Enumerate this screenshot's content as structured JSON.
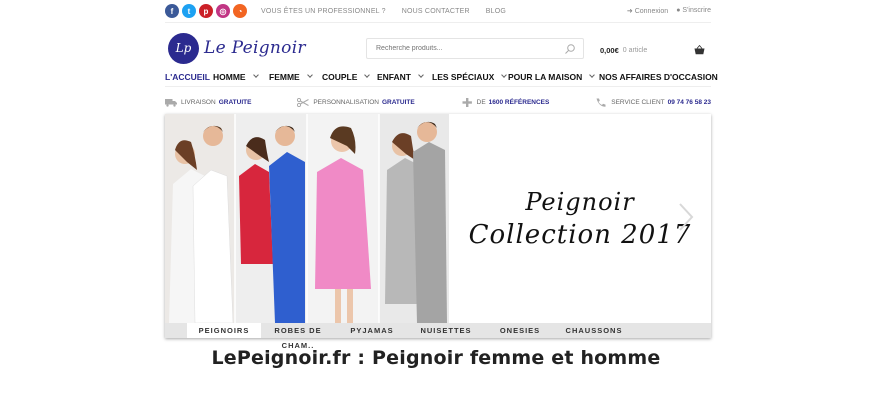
{
  "topbar": {
    "social": [
      {
        "name": "facebook",
        "glyph": "f",
        "color": "#3b5998"
      },
      {
        "name": "twitter",
        "glyph": "t",
        "color": "#1da1f2"
      },
      {
        "name": "pinterest",
        "glyph": "p",
        "color": "#cb2027"
      },
      {
        "name": "instagram",
        "glyph": "◎",
        "color": "#c13584"
      },
      {
        "name": "rss",
        "glyph": "◔",
        "color": "#f26522"
      }
    ],
    "links": [
      "VOUS ÊTES UN PROFESSIONNEL ?",
      "NOUS CONTACTER",
      "BLOG"
    ],
    "login_label": "Connexion",
    "register_label": "S'inscrire"
  },
  "header": {
    "logo_monogram": "Lp",
    "logo_text": "Le Peignoir",
    "search_placeholder": "Recherche produits...",
    "cart_amount": "0,00€",
    "cart_count": "0 article"
  },
  "nav": {
    "items": [
      {
        "label": "L'ACCUEIL",
        "dropdown": false,
        "active": true
      },
      {
        "label": "HOMME",
        "dropdown": true
      },
      {
        "label": "FEMME",
        "dropdown": true
      },
      {
        "label": "COUPLE",
        "dropdown": true
      },
      {
        "label": "ENFANT",
        "dropdown": true
      },
      {
        "label": "LES SPÉCIAUX",
        "dropdown": true
      },
      {
        "label": "POUR LA MAISON",
        "dropdown": true
      },
      {
        "label": "NOS AFFAIRES D'OCCASION",
        "dropdown": false
      }
    ]
  },
  "services": [
    {
      "icon": "truck-icon",
      "text": "LIVRAISON",
      "highlight": "GRATUITE"
    },
    {
      "icon": "scissors-icon",
      "text": "PERSONNALISATION",
      "highlight": "GRATUITE"
    },
    {
      "icon": "plus-icon",
      "text": "DE",
      "highlight": "1600 RÉFÉRENCES"
    },
    {
      "icon": "phone-icon",
      "text": "SERVICE CLIENT",
      "highlight": "09 74 76 58 23"
    }
  ],
  "slider": {
    "caption_line1": "Peignoir",
    "caption_line2": "Collection 2017",
    "tabs": [
      "PEIGNOIRS",
      "ROBES DE CHAM..",
      "PYJAMAS",
      "NUISETTES",
      "ONESIES",
      "CHAUSSONS"
    ],
    "active_tab": 0,
    "robe_colors": [
      "#ffffff",
      "#d7263d",
      "#2f5fcf",
      "#f08ac6",
      "#a9a9a9"
    ]
  },
  "page_title": "LePeignoir.fr : Peignoir femme et homme",
  "colors": {
    "accent": "#2b2a8f"
  }
}
